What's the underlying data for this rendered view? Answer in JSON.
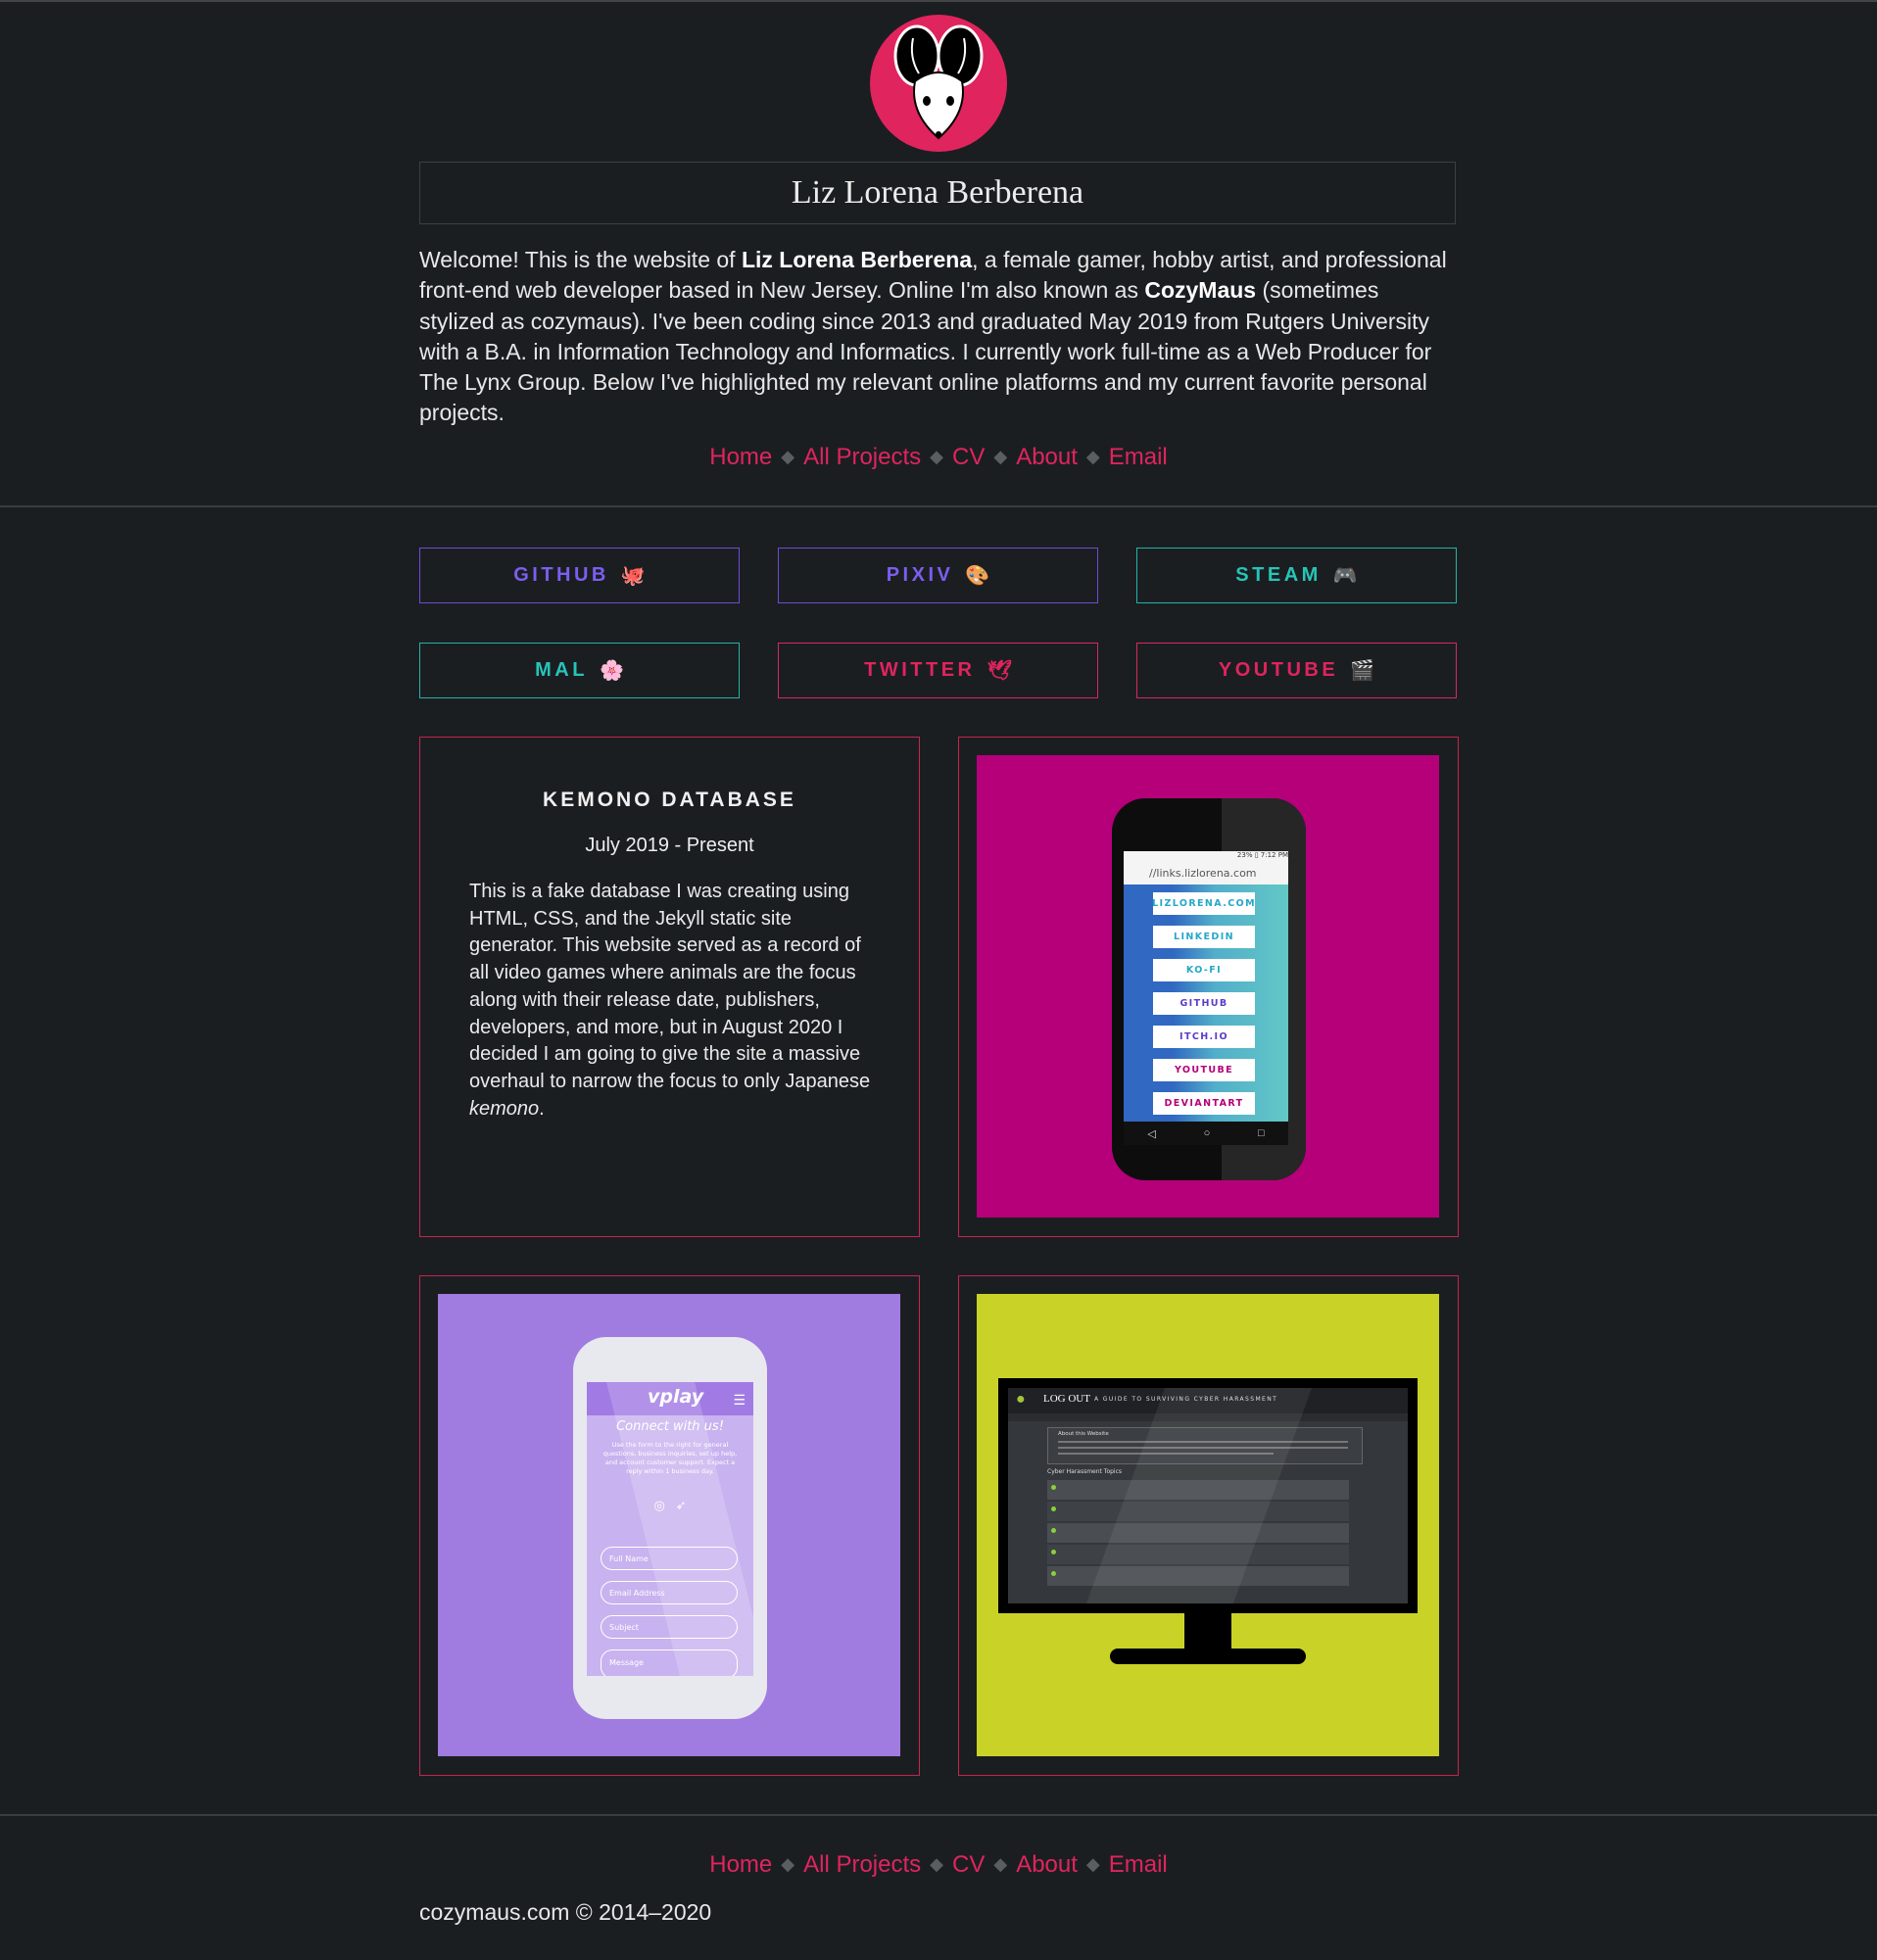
{
  "header": {
    "name": "Liz Lorena Berberena",
    "intro": {
      "p1": "Welcome! This is the website of ",
      "b1": "Liz Lorena Berberena",
      "p2": ", a female gamer, hobby artist, and professional front-end web developer based in New Jersey. Online I'm also known as ",
      "b2": "CozyMaus",
      "p3": " (sometimes stylized as cozymaus). I've been coding since 2013 and graduated May 2019 from Rutgers University with a B.A. in Information Technology and Informatics. I currently work full-time as a Web Producer for The Lynx Group. Below I've highlighted my relevant online platforms and my current favorite personal projects."
    }
  },
  "nav": {
    "items": [
      "Home",
      "All Projects",
      "CV",
      "About",
      "Email"
    ],
    "separator": "◆"
  },
  "platforms": [
    {
      "label": "GITHUB",
      "icon": "🐙",
      "icon_name": "octopus-icon",
      "color": "#7c5ef0"
    },
    {
      "label": "PIXIV",
      "icon": "🎨",
      "icon_name": "palette-icon",
      "color": "#7c5ef0"
    },
    {
      "label": "STEAM",
      "icon": "🎮",
      "icon_name": "gamepad-icon",
      "color": "#27c4b8"
    },
    {
      "label": "MAL",
      "icon": "🌸",
      "icon_name": "cherry-blossom-icon",
      "color": "#27c4b8"
    },
    {
      "label": "TWITTER",
      "icon": "🕊",
      "icon_name": "dove-icon",
      "color": "#e0245e"
    },
    {
      "label": "YOUTUBE",
      "icon": "🎬",
      "icon_name": "clapper-icon",
      "color": "#e0245e"
    }
  ],
  "projects": {
    "kemono": {
      "title": "KEMONO DATABASE",
      "date": "July 2019 - Present",
      "desc": "This is a fake database I was creating using HTML, CSS, and the Jekyll static site generator. This website served as a record of all video games where animals are the focus along with their release date, publishers, developers, and more, but in August 2020 I decided I am going to give the site a massive overhaul to narrow the focus to only Japanese ",
      "desc_em": "kemono",
      "desc_end": "."
    },
    "links_phone": {
      "bg": "#b5007a",
      "status": "23% ▯ 7:12 PM",
      "url": "//links.lizlorena.com",
      "buttons": [
        "LIZLORENA.COM",
        "LINKEDIN",
        "KO-FI",
        "GITHUB",
        "ITCH.IO",
        "YOUTUBE",
        "DEVIANTART"
      ]
    },
    "vplay_phone": {
      "bg": "#a07be0",
      "logo": "vplay",
      "heading": "Connect with us!",
      "body": "Use the form to the right for general questions, business inquiries, set up help, and account customer support. Expect a reply within 1 business day.",
      "fields": [
        "Full Name",
        "Email Address",
        "Subject",
        "Message"
      ]
    },
    "logout_monitor": {
      "bg": "#c9d327",
      "title": "LOG OUT",
      "subtitle": "A GUIDE TO SURVIVING CYBER HARASSMENT",
      "section": "Cyber Harassment Topics",
      "about": "About this Website"
    }
  },
  "footer": {
    "copyright": "cozymaus.com © 2014–2020"
  },
  "colors": {
    "background": "#1b1e21",
    "accent_pink": "#e0245e",
    "accent_purple": "#7c5ef0",
    "accent_teal": "#27c4b8"
  }
}
